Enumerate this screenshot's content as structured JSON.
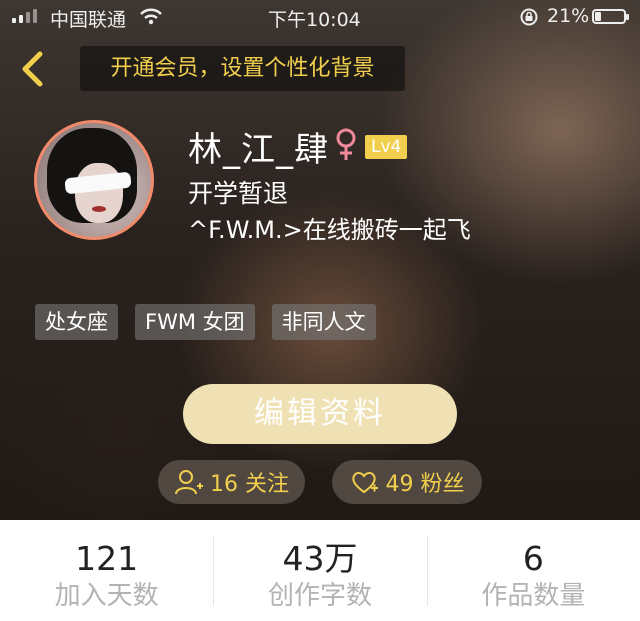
{
  "status_bar": {
    "carrier": "中国联通",
    "time": "下午10:04",
    "battery_percent": "21%",
    "battery_level": 0.21,
    "signal_icon": "signal-bars-icon",
    "wifi_icon": "wifi-icon",
    "orientation_lock_icon": "orientation-lock-icon"
  },
  "header": {
    "back_icon": "chevron-left-icon",
    "banner_text": "开通会员，设置个性化背景"
  },
  "profile": {
    "name": "林_江_肆",
    "gender_icon": "female-symbol-icon",
    "level": "Lv4",
    "bio_line1": "开学暂退",
    "bio_line2": "^F.W.M.>在线搬砖一起飞",
    "tags": [
      "处女座",
      "FWM 女团",
      "非同人文"
    ]
  },
  "actions": {
    "edit_button": "编辑资料",
    "follow_label": "16 关注",
    "fans_label": "49 粉丝"
  },
  "stats": [
    {
      "value": "121",
      "label": "加入天数"
    },
    {
      "value": "43万",
      "label": "创作字数"
    },
    {
      "value": "6",
      "label": "作品数量"
    }
  ],
  "colors": {
    "accent_yellow": "#f1cf4d",
    "avatar_ring": "#f08a6a",
    "gender_pink": "#f08a9a",
    "edit_button_bg": "#efe1b4"
  }
}
